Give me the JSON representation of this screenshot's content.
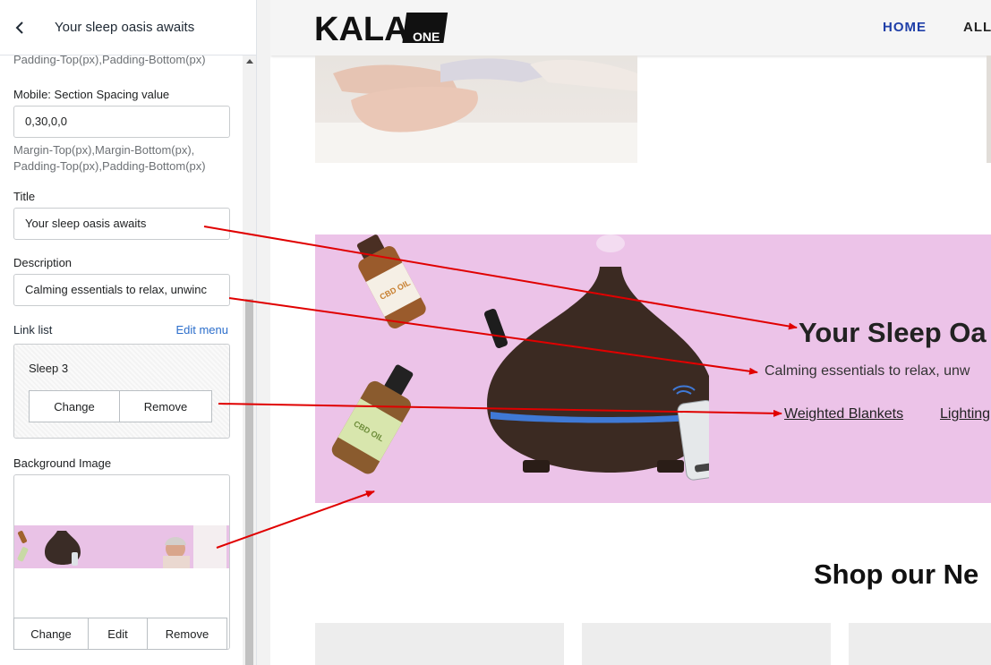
{
  "sidebar": {
    "header_title": "Your sleep oasis awaits",
    "top_hint": "Padding-Top(px),Padding-Bottom(px)",
    "mobile_spacing": {
      "label": "Mobile: Section Spacing value",
      "value": "0,30,0,0",
      "hint_line1": "Margin-Top(px),Margin-Bottom(px),",
      "hint_line2": "Padding-Top(px),Padding-Bottom(px)"
    },
    "title_field": {
      "label": "Title",
      "value": "Your sleep oasis awaits"
    },
    "description_field": {
      "label": "Description",
      "value": "Calming essentials to relax, unwinc"
    },
    "link_list": {
      "label": "Link list",
      "edit_label": "Edit menu",
      "selected": "Sleep 3",
      "change_label": "Change",
      "remove_label": "Remove"
    },
    "background_image": {
      "label": "Background Image",
      "change_label": "Change",
      "edit_label": "Edit",
      "remove_label": "Remove"
    }
  },
  "preview": {
    "logo_text": "KALA",
    "logo_badge": "ONE",
    "nav": {
      "home": "HOME",
      "all": "ALL"
    },
    "banner": {
      "title": "Your Sleep Oa",
      "description": "Calming essentials to relax, unw",
      "links": [
        "Weighted Blankets",
        "Lighting"
      ],
      "bottle_labels": [
        "CBD OIL",
        "CBD OIL"
      ]
    },
    "shop_title": "Shop our Ne"
  },
  "colors": {
    "banner_bg": "#ecc3e8",
    "accent_link": "#2c6ecb",
    "nav_active": "#1f3fa8",
    "annotation_arrow": "#e00000"
  }
}
